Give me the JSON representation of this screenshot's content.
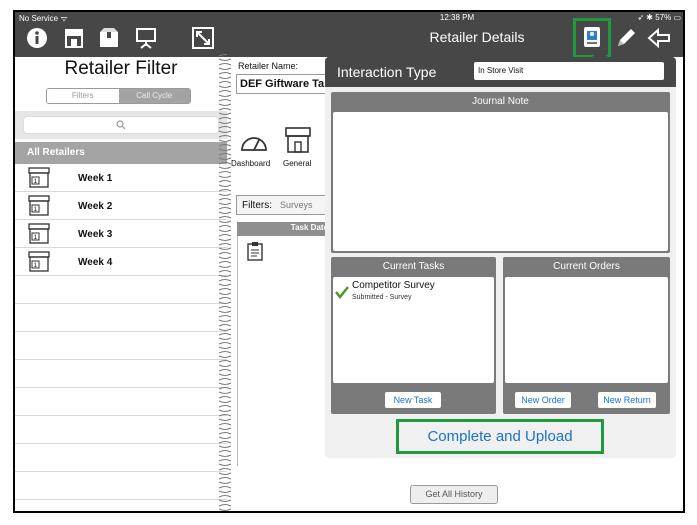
{
  "status": {
    "carrier": "No Service",
    "time": "12:38 PM",
    "battery": "57%"
  },
  "left": {
    "title": "Retailer Filter",
    "segments": [
      "Filters",
      "Call Cycle"
    ],
    "all_retailers": "All Retailers",
    "weeks": [
      "Week 1",
      "Week 2",
      "Week 3",
      "Week 4"
    ]
  },
  "right": {
    "title": "Retailer Details",
    "retailer_label": "Retailer Name:",
    "retailer_value": "DEF Giftware Ta",
    "tabs": [
      "Dashboard",
      "General"
    ],
    "filters_label": "Filters:",
    "filters_value": "Surveys",
    "task_date_header": "Task Date",
    "get_all_history": "Get All History"
  },
  "popover": {
    "title": "Interaction Type",
    "interaction_value": "In Store Visit",
    "journal_note": "Journal Note",
    "current_tasks": "Current Tasks",
    "current_orders": "Current Orders",
    "task_item": {
      "title": "Competitor Survey",
      "subtitle": "Submitted - Survey"
    },
    "new_task": "New Task",
    "new_order": "New Order",
    "new_return": "New Return",
    "complete_upload": "Complete and Upload"
  },
  "colors": {
    "toolbar": "#474747",
    "accent": "#1a73c9",
    "highlight": "#1f9a3f",
    "panel": "#7a7a7a"
  }
}
